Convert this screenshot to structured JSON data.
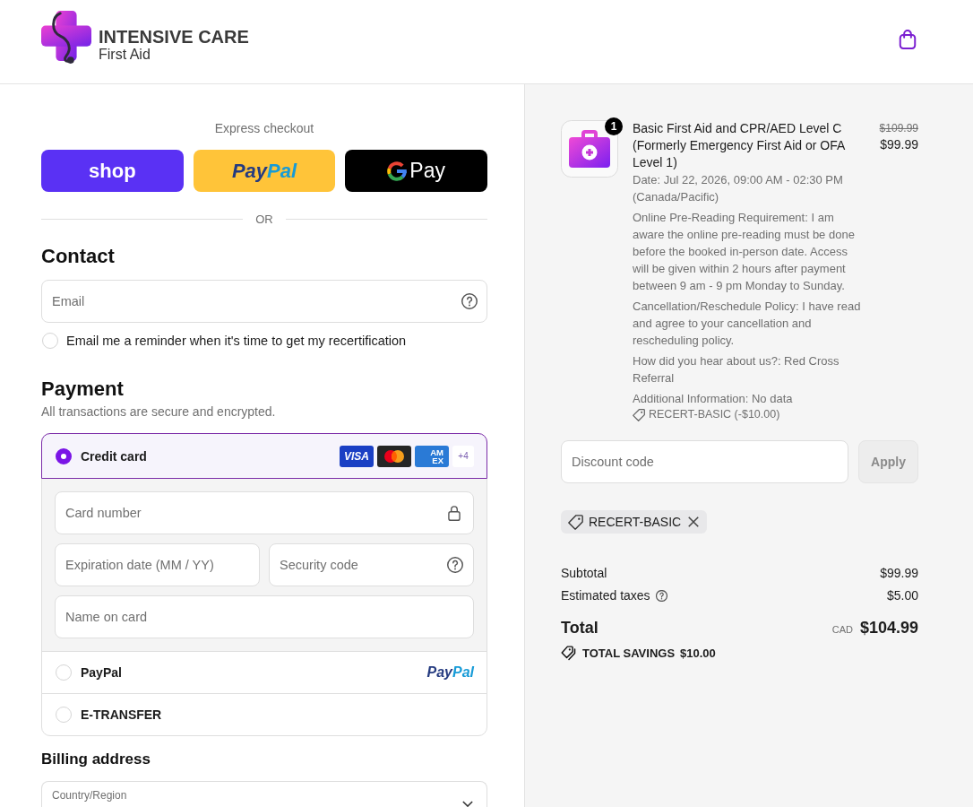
{
  "header": {
    "brand_name": "INTENSIVE CARE",
    "brand_tagline": "First Aid"
  },
  "express_checkout": {
    "title": "Express checkout",
    "buttons": [
      {
        "kind": "shop",
        "label": "shop"
      },
      {
        "kind": "paypal",
        "label_parts": [
          "Pay",
          "Pal"
        ]
      },
      {
        "kind": "gpay",
        "label": "Pay"
      }
    ],
    "divider": "OR"
  },
  "contact": {
    "title": "Contact",
    "email": {
      "placeholder": "Email"
    },
    "reminder": {
      "label": "Email me a reminder when it's time to get my recertification",
      "checked": false
    }
  },
  "payment": {
    "title": "Payment",
    "subtitle": "All transactions are secure and encrypted.",
    "methods": [
      {
        "kind": "card",
        "label": "Credit card",
        "selected": true,
        "brands": [
          {
            "kind": "visa",
            "label": "VISA"
          },
          {
            "kind": "mastercard"
          },
          {
            "kind": "amex",
            "lines": [
              "AM",
              "EX"
            ]
          }
        ],
        "more": "+4",
        "fields": [
          [
            {
              "kind": "card_number",
              "placeholder": "Card number"
            }
          ],
          [
            {
              "kind": "expiry",
              "placeholder": "Expiration date (MM / YY)"
            },
            {
              "kind": "security_code",
              "placeholder": "Security code"
            }
          ],
          [
            {
              "kind": "name",
              "placeholder": "Name on card"
            }
          ]
        ]
      },
      {
        "kind": "paypal",
        "label": "PayPal",
        "selected": false,
        "label_parts": [
          "Pay",
          "Pal"
        ]
      },
      {
        "kind": "plain",
        "label": "E-TRANSFER",
        "selected": false
      }
    ]
  },
  "billing": {
    "title": "Billing address",
    "country": {
      "label": "Country/Region"
    }
  },
  "order": {
    "items": [
      {
        "quantity": "1",
        "title": "Basic First Aid and CPR/AED Level C (Formerly Emergency First Aid or OFA Level 1)",
        "original_price": "$109.99",
        "price": "$99.99",
        "details": [
          "Date: Jul 22, 2026, 09:00 AM - 02:30 PM (Canada/Pacific)",
          "Online Pre-Reading Requirement: I am aware the online pre-reading must be done before the booked in-person date. Access will be given within 2 hours after payment between 9 am - 9 pm Monday to Sunday.",
          "Cancellation/Reschedule Policy: I have read and agree to your cancellation and rescheduling policy.",
          "How did you hear about us?: Red Cross Referral",
          "Additional Information: No data"
        ],
        "discount": "RECERT-BASIC (-$10.00)"
      }
    ],
    "discount": {
      "placeholder": "Discount code",
      "apply": {
        "label": "Apply",
        "disabled": true
      }
    },
    "applied_codes": [
      {
        "code": "RECERT-BASIC"
      }
    ],
    "summary": [
      {
        "label": "Subtotal",
        "value": "$99.99",
        "info": false
      },
      {
        "label": "Estimated taxes",
        "value": "$5.00",
        "info": true
      }
    ],
    "total": {
      "label": "Total",
      "currency": "CAD",
      "amount": "$104.99"
    },
    "savings": {
      "label": "TOTAL SAVINGS",
      "amount": "$10.00"
    }
  }
}
